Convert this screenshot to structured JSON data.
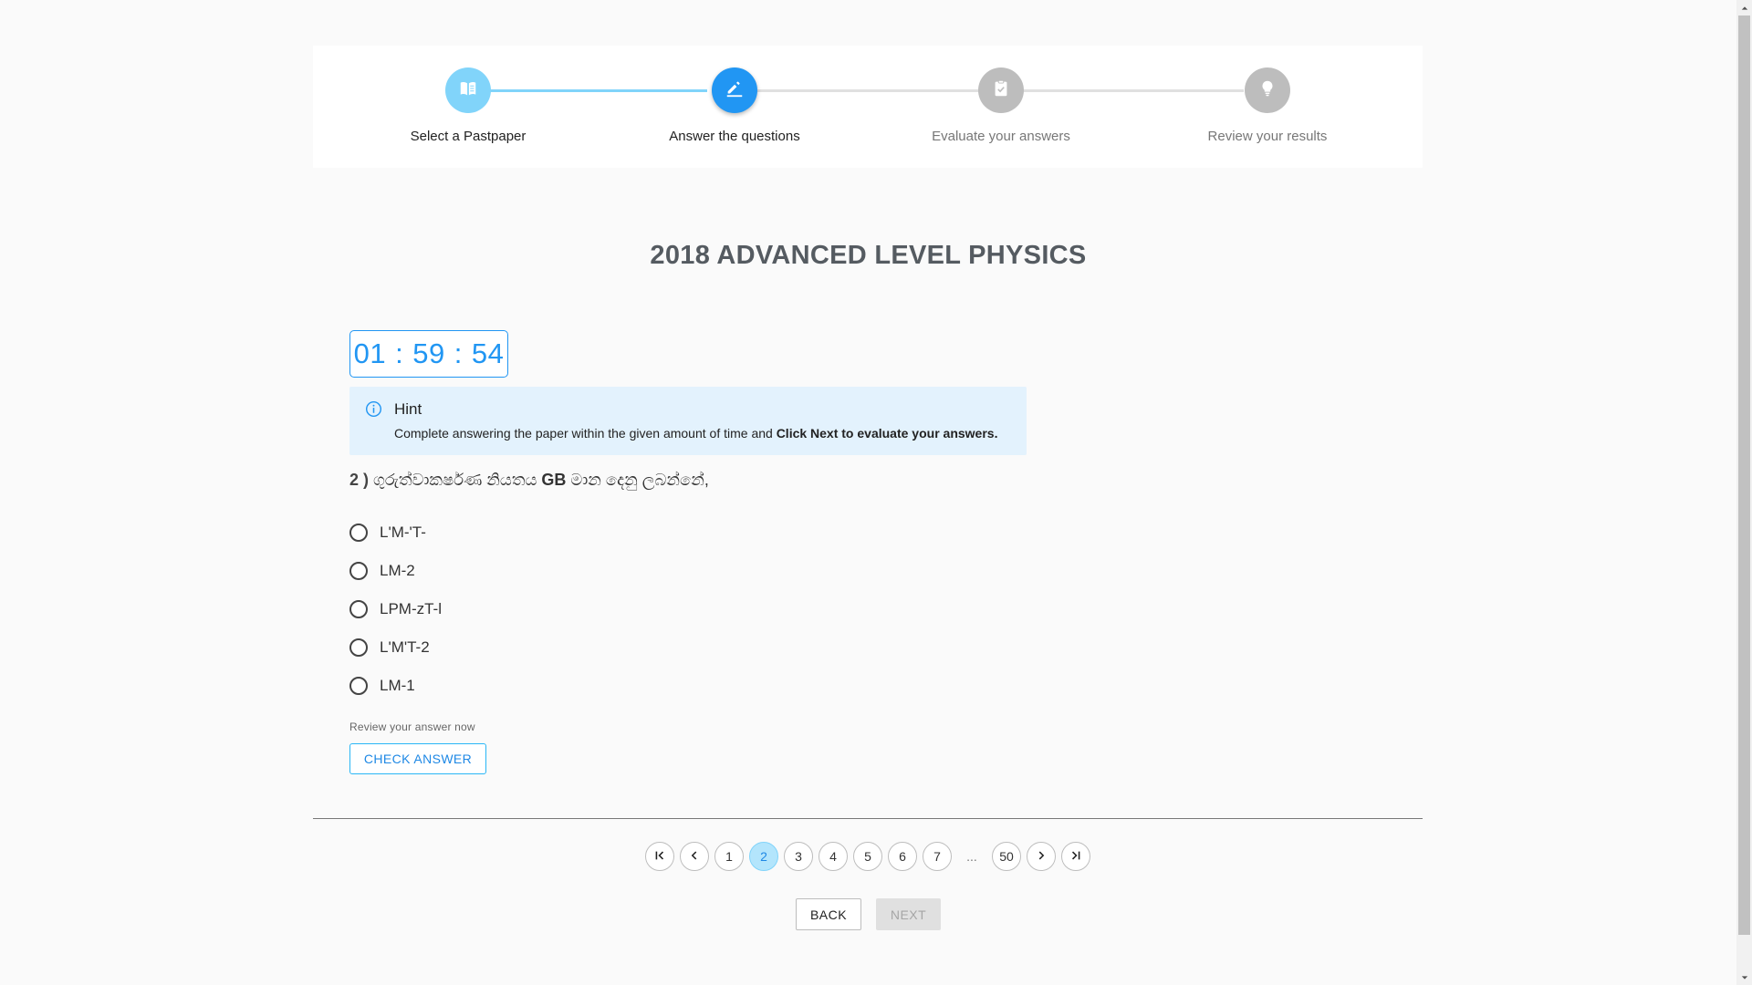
{
  "stepper": {
    "steps": [
      {
        "label": "Select a Pastpaper",
        "state": "done",
        "icon": "book-icon"
      },
      {
        "label": "Answer the questions",
        "state": "active",
        "icon": "pencil-icon"
      },
      {
        "label": "Evaluate your answers",
        "state": "pending",
        "icon": "check-clipboard-icon"
      },
      {
        "label": "Review your results",
        "state": "pending",
        "icon": "lightbulb-icon"
      }
    ]
  },
  "paper": {
    "title": "2018 ADVANCED LEVEL PHYSICS"
  },
  "timer": {
    "hours": "01",
    "minutes": "59",
    "seconds": "54",
    "separator": ":"
  },
  "hint": {
    "title": "Hint",
    "body_prefix": "Complete answering the paper within the given amount of time and ",
    "body_bold": "Click Next to evaluate your answers.",
    "icon": "info-icon"
  },
  "question": {
    "number": "2 )",
    "text_before": " ගුරුත්වාකර්ෂණ නියතය ",
    "text_symbol": "GB",
    "text_after": " මාන දෙනු ලබන්නේ,",
    "options": [
      "L'M-'T-",
      "LM-2",
      "LPM-zT-l",
      "L'M'T-2",
      "LM-1"
    ]
  },
  "review": {
    "note": "Review your answer now",
    "check_button": "CHECK ANSWER"
  },
  "pagination": {
    "pages": [
      "1",
      "2",
      "3",
      "4",
      "5",
      "6",
      "7"
    ],
    "current_page": "2",
    "ellipsis": "...",
    "last_page": "50"
  },
  "nav": {
    "back_label": "BACK",
    "next_label": "NEXT"
  },
  "colors": {
    "primary": "#2196f3",
    "done": "#81d4fa",
    "pending": "#bdbdbd",
    "hint_bg": "#e3f2fd"
  }
}
